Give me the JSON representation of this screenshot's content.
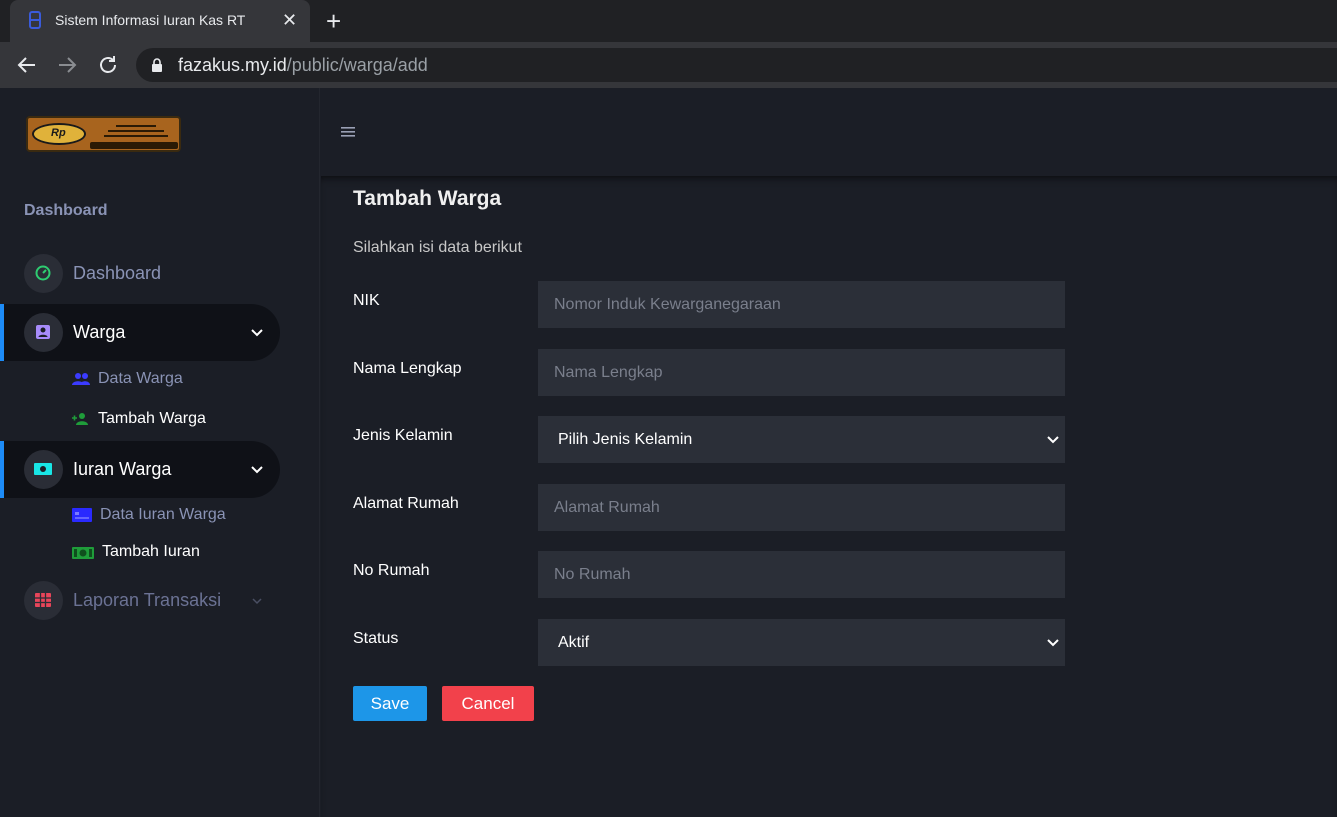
{
  "browser": {
    "tab_title": "Sistem Informasi Iuran Kas RT",
    "url_host": "fazakus.my.id",
    "url_path": "/public/warga/add"
  },
  "sidebar": {
    "section_title": "Dashboard",
    "items": [
      {
        "label": "Dashboard",
        "icon": "speedometer-icon",
        "icon_color": "#2ecc71"
      },
      {
        "label": "Warga",
        "icon": "user-badge-icon",
        "icon_color": "#a78bfa",
        "expanded": true,
        "children": [
          {
            "label": "Data Warga",
            "icon": "users-icon",
            "icon_color": "#3b3bff"
          },
          {
            "label": "Tambah Warga",
            "icon": "user-plus-icon",
            "icon_color": "#1f9d3a"
          }
        ]
      },
      {
        "label": "Iuran Warga",
        "icon": "money-icon",
        "icon_color": "#19e6e6",
        "expanded": true,
        "children": [
          {
            "label": "Data Iuran Warga",
            "icon": "card-icon",
            "icon_color": "#2a2aff"
          },
          {
            "label": "Tambah Iuran",
            "icon": "cash-icon",
            "icon_color": "#1f9d3a"
          }
        ]
      },
      {
        "label": "Laporan Transaksi",
        "icon": "grid-icon",
        "icon_color": "#e8455a"
      }
    ]
  },
  "page": {
    "title": "Tambah Warga",
    "subtitle": "Silahkan isi data berikut"
  },
  "form": {
    "nik_label": "NIK",
    "nik_placeholder": "Nomor Induk Kewarganegaraan",
    "nama_label": "Nama Lengkap",
    "nama_placeholder": "Nama Lengkap",
    "jk_label": "Jenis Kelamin",
    "jk_value": "Pilih Jenis Kelamin",
    "alamat_label": "Alamat Rumah",
    "alamat_placeholder": "Alamat Rumah",
    "norumah_label": "No Rumah",
    "norumah_placeholder": "No Rumah",
    "status_label": "Status",
    "status_value": "Aktif",
    "save_label": "Save",
    "cancel_label": "Cancel"
  },
  "colors": {
    "accent": "#1d8cf8",
    "save": "#1d96e8",
    "cancel": "#f2414b"
  }
}
